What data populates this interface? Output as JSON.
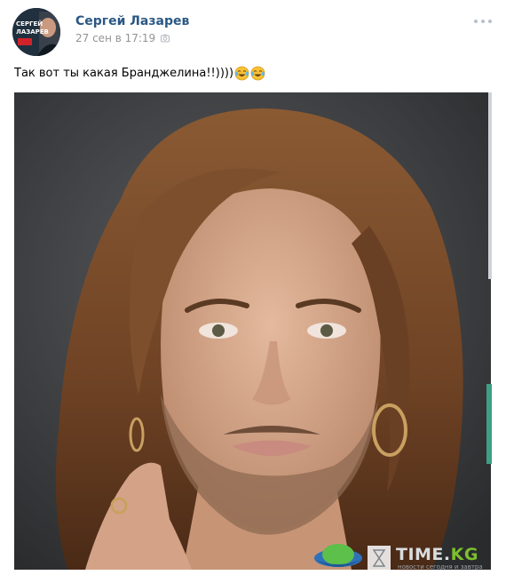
{
  "post": {
    "author": "Сергей Лазарев",
    "date": "27 сен в 17:19",
    "text": "Так вот ты какая Бранджелина!!))))",
    "emoji": [
      "face-with-tears-of-joy-icon",
      "face-with-tears-of-joy-icon"
    ]
  },
  "avatar": {
    "line1": "СЕРГЕЙ",
    "line2": "ЛАЗАРЕВ"
  },
  "watermark": {
    "title": "TIME.",
    "title_accent": "KG",
    "subtitle": "новости сегодня и завтра"
  },
  "colors": {
    "author_link": "#2a5885",
    "date": "#939393",
    "photo_background": "#3b3d40",
    "hair": "#7a4a2a",
    "skin": "#d7a98b",
    "accent_green": "#3e9e86"
  }
}
